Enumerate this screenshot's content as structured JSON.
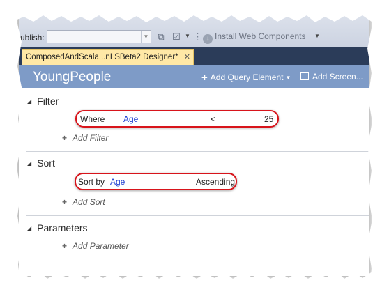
{
  "toolbar": {
    "publish_label": "ublish:",
    "install_label": "Install Web Components"
  },
  "document_tab": {
    "title": "ComposedAndScala...nLSBeta2 Designer*"
  },
  "designer": {
    "title": "YoungPeople",
    "add_query_element": "Add Query Element",
    "add_screen": "Add Screen..."
  },
  "filter": {
    "heading": "Filter",
    "where_label": "Where",
    "field": "Age",
    "operator": "<",
    "value": "25",
    "add_filter": "Add Filter"
  },
  "sort": {
    "heading": "Sort",
    "sort_by_label": "Sort by",
    "field": "Age",
    "direction": "Ascending",
    "add_sort": "Add Sort"
  },
  "parameters": {
    "heading": "Parameters",
    "add_parameter": "Add Parameter"
  },
  "colors": {
    "header_band": "#7e9bc7",
    "tab_highlight": "#ffe8a6",
    "annotation_red": "#d8141b",
    "link_blue": "#1f3fd1"
  }
}
